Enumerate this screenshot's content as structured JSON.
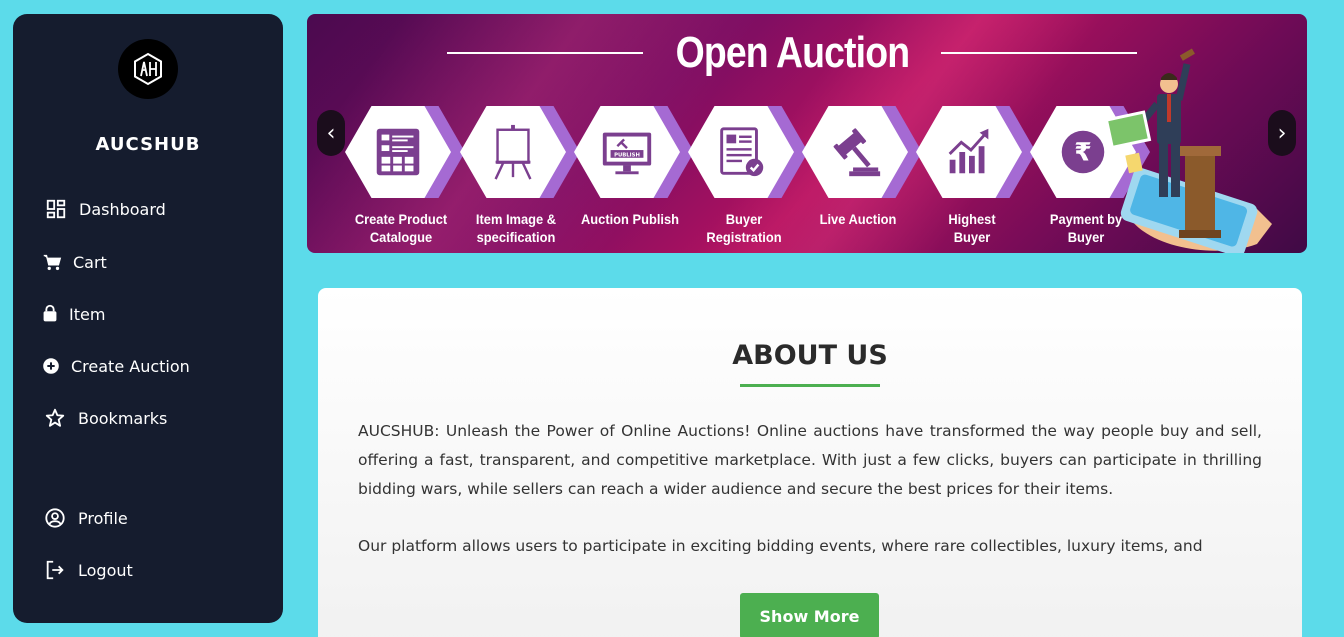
{
  "sidebar": {
    "brand": "AUCSHUB",
    "logo_text": "AH",
    "items": [
      {
        "label": "Dashboard",
        "icon": "dashboard-icon"
      },
      {
        "label": "Cart",
        "icon": "cart-icon"
      },
      {
        "label": "Item",
        "icon": "bag-icon"
      },
      {
        "label": "Create Auction",
        "icon": "plus-circle-icon"
      },
      {
        "label": "Bookmarks",
        "icon": "star-icon"
      }
    ],
    "bottom_items": [
      {
        "label": "Profile",
        "icon": "user-circle-icon"
      },
      {
        "label": "Logout",
        "icon": "logout-icon"
      }
    ]
  },
  "banner": {
    "title": "Open Auction",
    "prev": "‹",
    "next": "›",
    "steps": [
      {
        "line1": "Create Product",
        "line2": "Catalogue",
        "icon": "catalogue-icon"
      },
      {
        "line1": "Item Image &",
        "line2": "specification",
        "icon": "easel-icon"
      },
      {
        "line1": "Auction Publish",
        "line2": "",
        "icon": "publish-monitor-icon",
        "badge": "PUBLISH"
      },
      {
        "line1": "Buyer",
        "line2": "Registration",
        "icon": "registration-form-icon"
      },
      {
        "line1": "Live Auction",
        "line2": "",
        "icon": "gavel-icon"
      },
      {
        "line1": "Highest",
        "line2": "Buyer",
        "icon": "growth-chart-icon"
      },
      {
        "line1": "Payment by",
        "line2": "Buyer",
        "icon": "rupee-icon",
        "symbol": "₹"
      }
    ]
  },
  "about": {
    "title": "ABOUT US",
    "paragraph1": "AUCSHUB: Unleash the Power of Online Auctions! Online auctions have transformed the way people buy and sell, offering a fast, transparent, and competitive marketplace. With just a few clicks, buyers can participate in thrilling bidding wars, while sellers can reach a wider audience and secure the best prices for their items.",
    "paragraph2": "Our platform allows users to participate in exciting bidding events, where rare collectibles, luxury items, and",
    "button": "Show More"
  },
  "colors": {
    "background": "#5cdbea",
    "sidebar": "#151c2e",
    "accent_green": "#4caf50",
    "banner_purple": "#7a0d62"
  }
}
